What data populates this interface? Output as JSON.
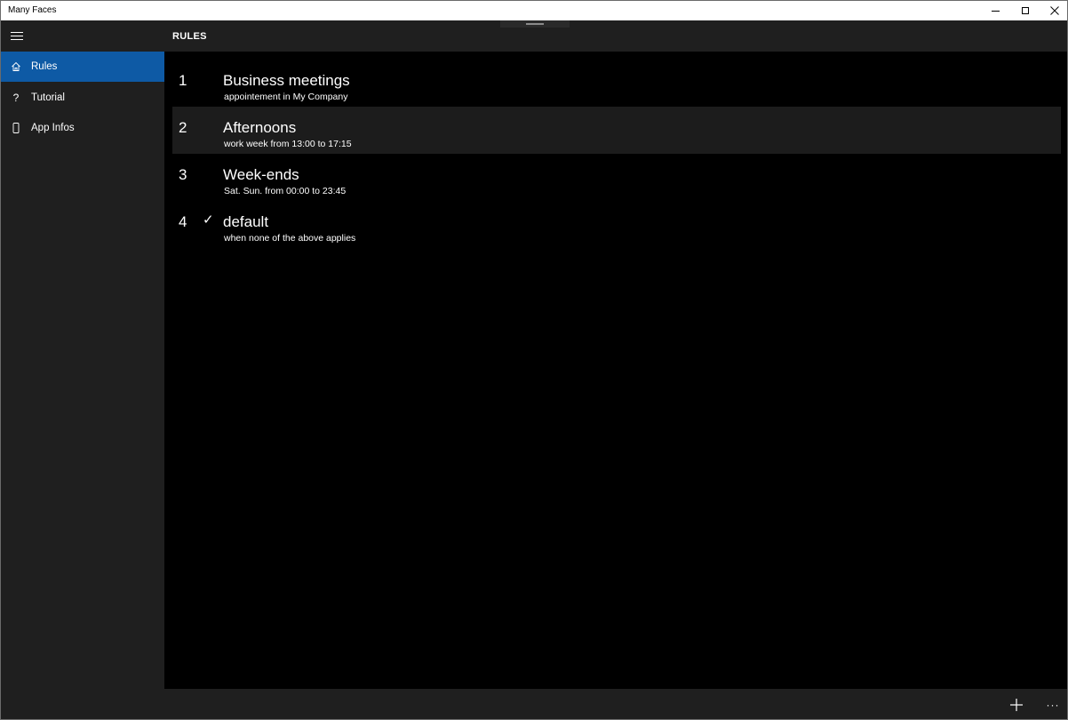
{
  "window": {
    "title": "Many Faces",
    "controls": {
      "minimize": "minimize-icon",
      "maximize": "maximize-icon",
      "close": "close-icon"
    }
  },
  "sidebar": {
    "menu_icon": "hamburger-icon",
    "items": [
      {
        "label": "Rules",
        "icon": "home-icon",
        "glyph": "⌂",
        "active": true
      },
      {
        "label": "Tutorial",
        "icon": "question-icon",
        "glyph": "?",
        "active": false
      },
      {
        "label": "App Infos",
        "icon": "phone-icon",
        "glyph": "▯",
        "active": false
      }
    ]
  },
  "header": {
    "title": "RULES"
  },
  "rules": [
    {
      "number": "1",
      "name": "Business meetings",
      "description": "appointement in My Company",
      "checked": false
    },
    {
      "number": "2",
      "name": "Afternoons",
      "description": "work week from 13:00 to 17:15",
      "checked": false
    },
    {
      "number": "3",
      "name": "Week-ends",
      "description": "Sat. Sun. from 00:00 to 23:45",
      "checked": false
    },
    {
      "number": "4",
      "name": "default",
      "description": "when none of the above applies",
      "checked": true,
      "check_glyph": "✓"
    }
  ],
  "bottombar": {
    "add_glyph": "+",
    "more_glyph": "···"
  },
  "colors": {
    "accent": "#0e5aa5",
    "panel": "#1f1f1f",
    "background": "#000000"
  }
}
